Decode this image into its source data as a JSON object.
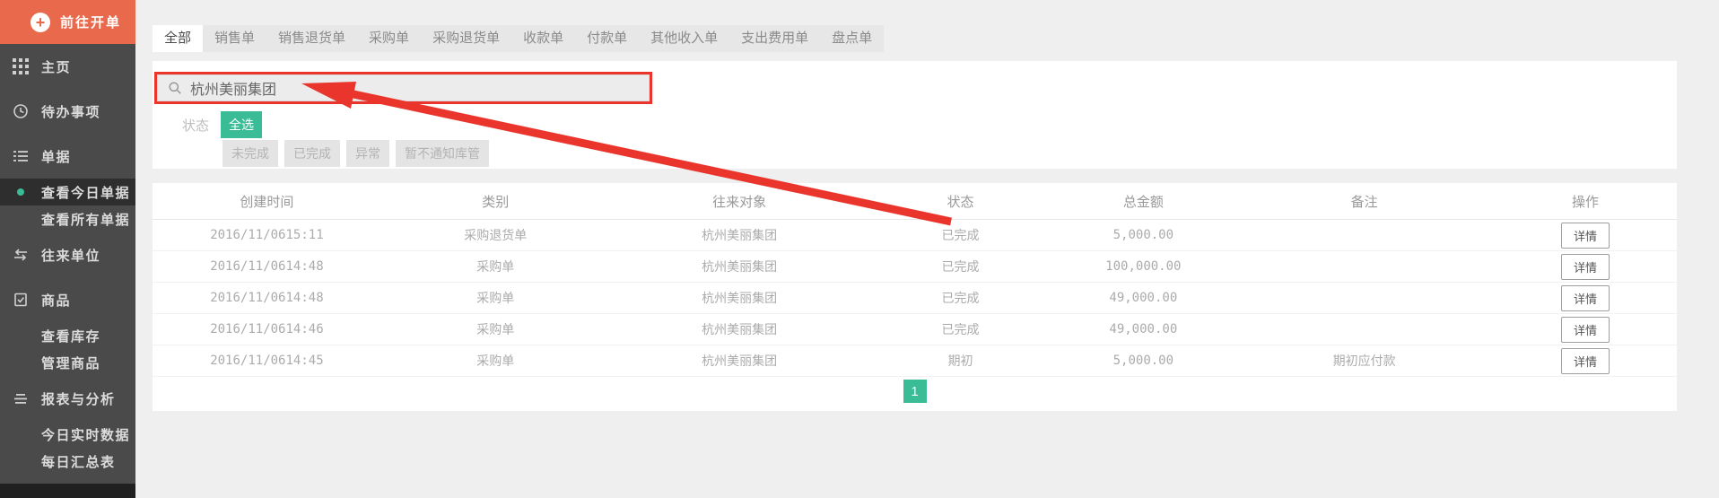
{
  "colors": {
    "orange": "#e8694b",
    "green": "#3abc96",
    "red": "#e9352c",
    "sidebar_bg": "#4a4a4a",
    "sidebar_active": "#2e2e2e",
    "page_bg": "#efefef"
  },
  "sidebar": {
    "cta_label": "前往开单",
    "items": [
      {
        "id": "home",
        "label": "主页",
        "icon": "grid-icon",
        "type": "item"
      },
      {
        "id": "todo",
        "label": "待办事项",
        "icon": "clock-icon",
        "type": "item"
      },
      {
        "id": "orders",
        "label": "单据",
        "icon": "list-icon",
        "type": "item"
      },
      {
        "id": "today-orders",
        "label": "查看今日单据",
        "type": "subitem",
        "active": true
      },
      {
        "id": "all-orders",
        "label": "查看所有单据",
        "type": "subitem"
      },
      {
        "id": "contacts",
        "label": "往来单位",
        "icon": "swap-icon",
        "type": "item"
      },
      {
        "id": "products",
        "label": "商品",
        "icon": "clipboard-icon",
        "type": "item"
      },
      {
        "id": "view-inventory",
        "label": "查看库存",
        "type": "subitem"
      },
      {
        "id": "manage-products",
        "label": "管理商品",
        "type": "subitem"
      },
      {
        "id": "reports",
        "label": "报表与分析",
        "icon": "lines-icon",
        "type": "item"
      },
      {
        "id": "today-realtime",
        "label": "今日实时数据",
        "type": "subitem"
      },
      {
        "id": "daily-summary",
        "label": "每日汇总表",
        "type": "subitem"
      }
    ]
  },
  "tabs": {
    "active": "全部",
    "items": [
      {
        "id": "all",
        "label": "全部"
      },
      {
        "id": "sales",
        "label": "销售单"
      },
      {
        "id": "sales-return",
        "label": "销售退货单"
      },
      {
        "id": "purchase",
        "label": "采购单"
      },
      {
        "id": "purchase-return",
        "label": "采购退货单"
      },
      {
        "id": "receipt",
        "label": "收款单"
      },
      {
        "id": "payment",
        "label": "付款单"
      },
      {
        "id": "other-income",
        "label": "其他收入单"
      },
      {
        "id": "expense",
        "label": "支出费用单"
      },
      {
        "id": "stocktake",
        "label": "盘点单"
      }
    ]
  },
  "search": {
    "value": "杭州美丽集团"
  },
  "status_filter": {
    "label": "状态",
    "selected": "全选",
    "options": [
      {
        "id": "unfinished",
        "label": "未完成"
      },
      {
        "id": "finished",
        "label": "已完成"
      },
      {
        "id": "abnormal",
        "label": "异常"
      },
      {
        "id": "no-notify-warehouse",
        "label": "暂不通知库管"
      }
    ]
  },
  "table": {
    "headers": [
      "创建时间",
      "类别",
      "往来对象",
      "状态",
      "总金额",
      "备注",
      "操作"
    ],
    "action_label": "详情",
    "rows": [
      {
        "created": "2016/11/0615:11",
        "category": "采购退货单",
        "party": "杭州美丽集团",
        "status": "已完成",
        "amount": "5,000.00",
        "note": ""
      },
      {
        "created": "2016/11/0614:48",
        "category": "采购单",
        "party": "杭州美丽集团",
        "status": "已完成",
        "amount": "100,000.00",
        "note": ""
      },
      {
        "created": "2016/11/0614:48",
        "category": "采购单",
        "party": "杭州美丽集团",
        "status": "已完成",
        "amount": "49,000.00",
        "note": ""
      },
      {
        "created": "2016/11/0614:46",
        "category": "采购单",
        "party": "杭州美丽集团",
        "status": "已完成",
        "amount": "49,000.00",
        "note": ""
      },
      {
        "created": "2016/11/0614:45",
        "category": "采购单",
        "party": "杭州美丽集团",
        "status": "期初",
        "amount": "5,000.00",
        "note": "期初应付款"
      }
    ]
  },
  "pagination": {
    "current": "1"
  }
}
